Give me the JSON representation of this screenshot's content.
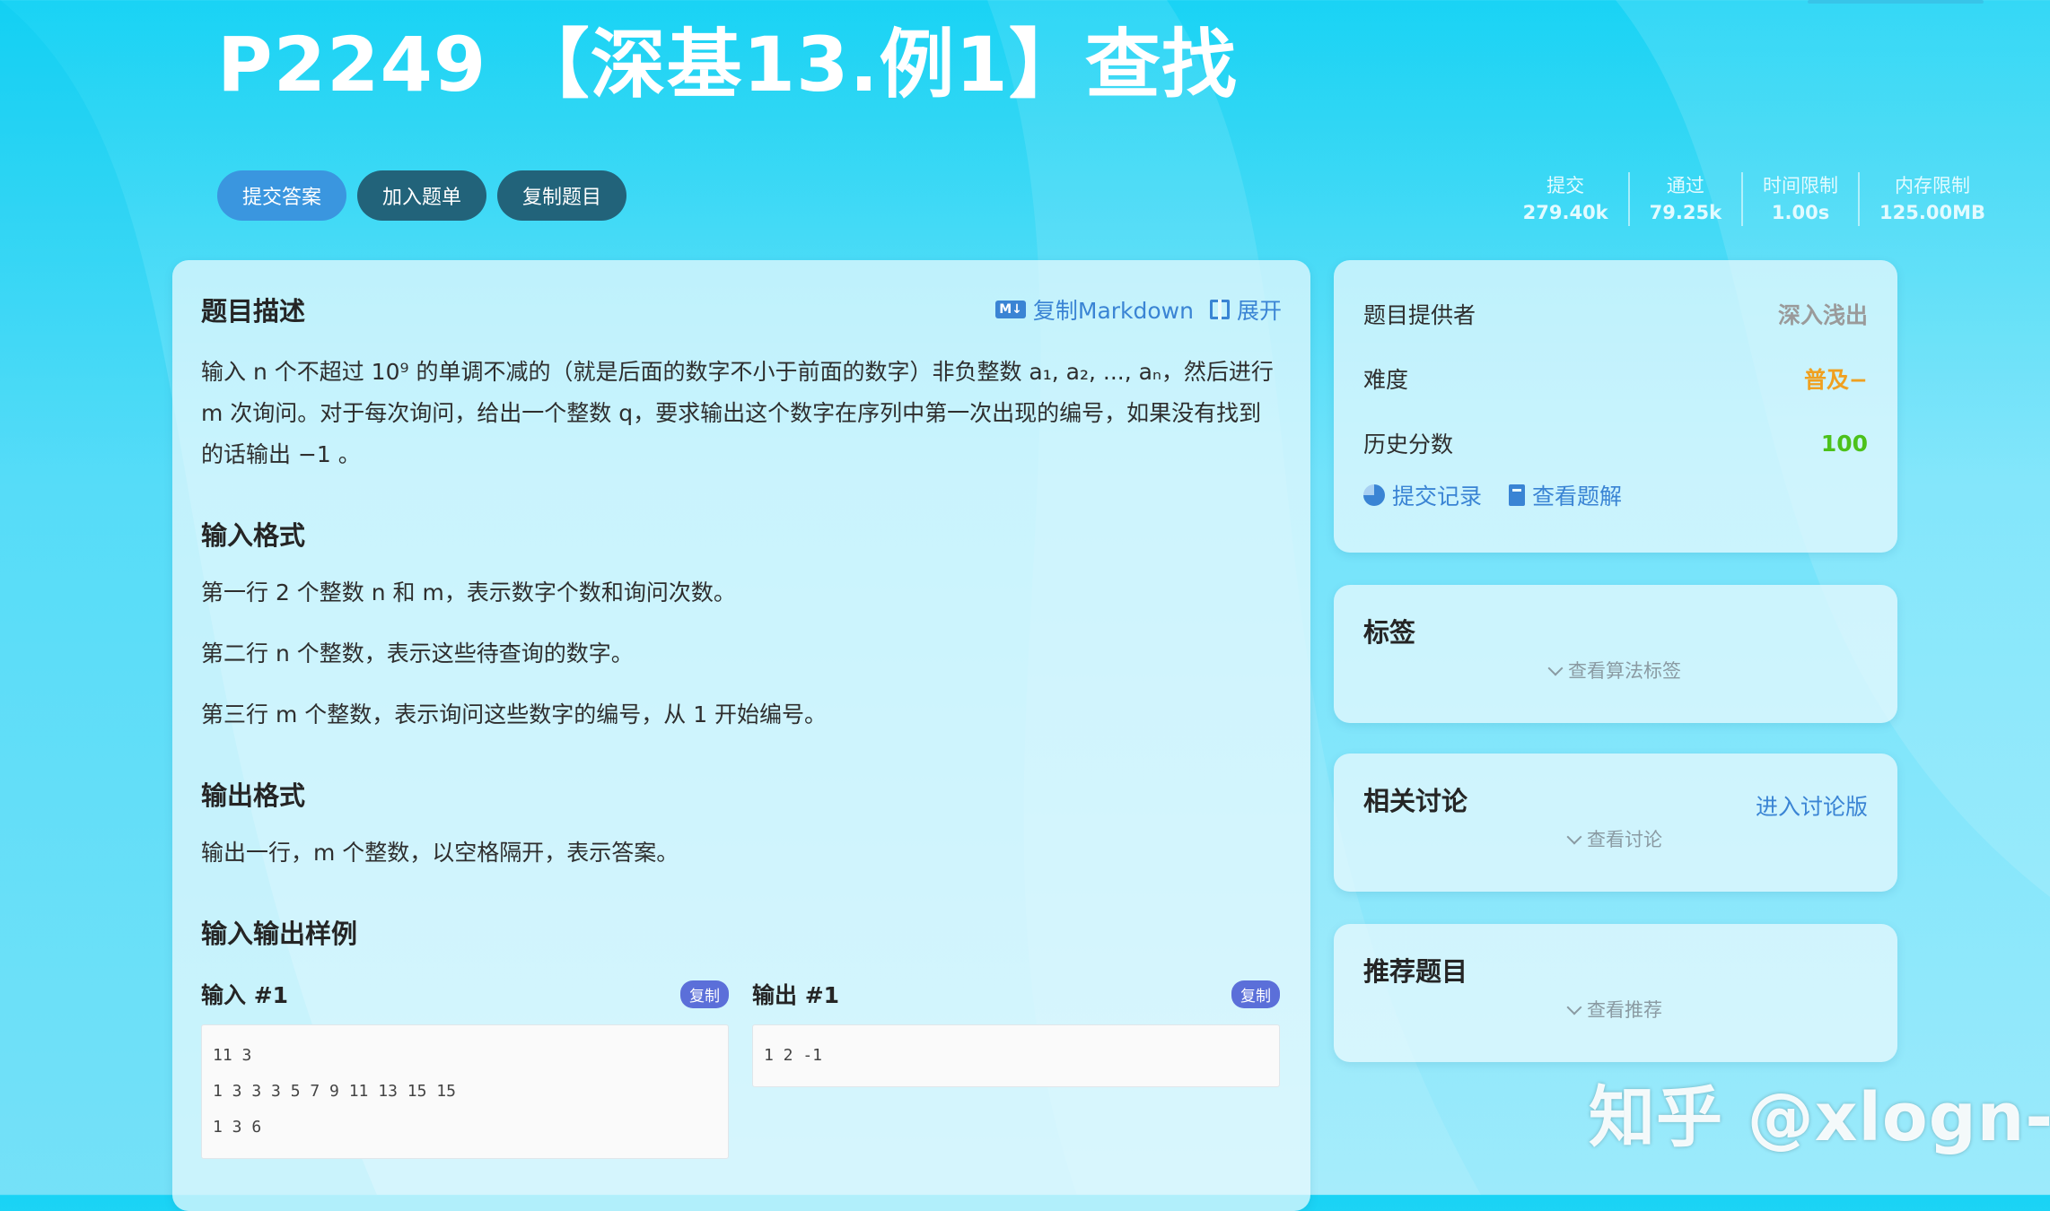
{
  "problem": {
    "title": "P2249 【深基13.例1】查找"
  },
  "actions": {
    "submit": "提交答案",
    "add_to_list": "加入题单",
    "copy_problem": "复制题目"
  },
  "stats": [
    {
      "label": "提交",
      "value": "279.40k"
    },
    {
      "label": "通过",
      "value": "79.25k"
    },
    {
      "label": "时间限制",
      "value": "1.00s"
    },
    {
      "label": "内存限制",
      "value": "125.00MB"
    }
  ],
  "description": {
    "heading": "题目描述",
    "copy_markdown": "复制Markdown",
    "md_badge": "M↓",
    "expand": "展开",
    "text": "输入 n 个不超过 10⁹ 的单调不减的（就是后面的数字不小于前面的数字）非负整数 a₁, a₂, ..., aₙ，然后进行 m 次询问。对于每次询问，给出一个整数 q，要求输出这个数字在序列中第一次出现的编号，如果没有找到的话输出 −1 。"
  },
  "input_format": {
    "heading": "输入格式",
    "lines": [
      "第一行 2 个整数 n 和 m，表示数字个数和询问次数。",
      "第二行 n 个整数，表示这些待查询的数字。",
      "第三行 m 个整数，表示询问这些数字的编号，从 1 开始编号。"
    ]
  },
  "output_format": {
    "heading": "输出格式",
    "text": "输出一行，m 个整数，以空格隔开，表示答案。"
  },
  "samples": {
    "heading": "输入输出样例",
    "input_title": "输入 #1",
    "output_title": "输出 #1",
    "copy_label": "复制",
    "input": "11 3\n1 3 3 3 5 7 9 11 13 15 15\n1 3 6",
    "output": "1 2 -1"
  },
  "info": {
    "provider_label": "题目提供者",
    "provider_value": "深入浅出",
    "difficulty_label": "难度",
    "difficulty_value": "普及−",
    "score_label": "历史分数",
    "score_value": "100",
    "submissions_link": "提交记录",
    "solutions_link": "查看题解"
  },
  "tags": {
    "title": "标签",
    "expander": "查看算法标签"
  },
  "discussion": {
    "title": "相关讨论",
    "link": "进入讨论版",
    "expander": "查看讨论"
  },
  "recommend": {
    "title": "推荐题目",
    "expander": "查看推荐"
  },
  "watermark": "知乎 @xlogn-x",
  "colors": {
    "accent": "#3a84d4",
    "primary_button": "#3a96df",
    "dark_button": "#22637a",
    "difficulty": "#f0a020",
    "score": "#4cc11a"
  }
}
